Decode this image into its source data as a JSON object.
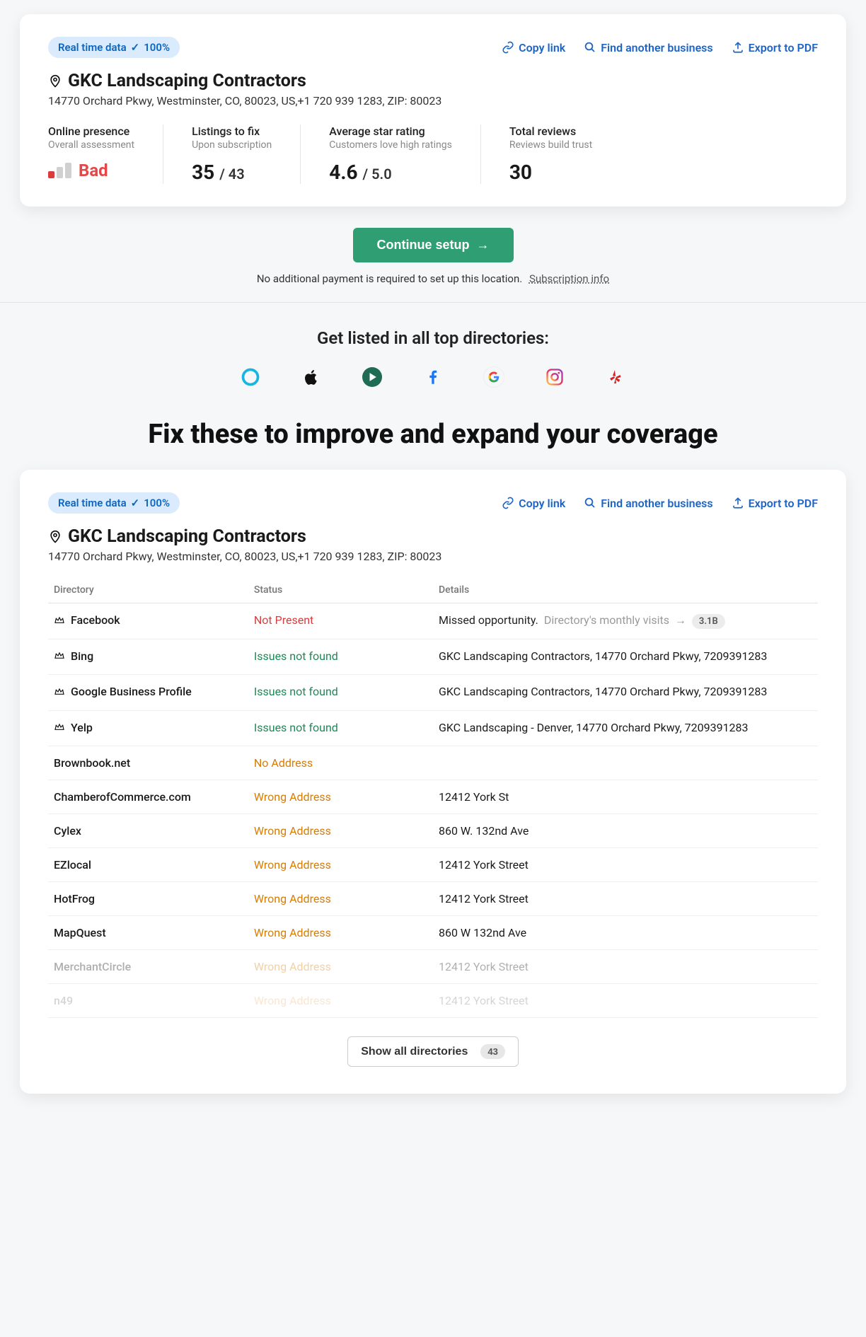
{
  "pill": {
    "label": "Real time data",
    "percent": "100%"
  },
  "actions": {
    "copy": "Copy link",
    "find": "Find another business",
    "export": "Export to PDF"
  },
  "business": {
    "name": "GKC Landscaping Contractors",
    "address": "14770 Orchard Pkwy, Westminster, CO, 80023, US,+1 720 939 1283, ZIP: 80023"
  },
  "stats": {
    "presence": {
      "label": "Online presence",
      "sub": "Overall assessment",
      "value": "Bad"
    },
    "listings": {
      "label": "Listings to fix",
      "sub": "Upon subscription",
      "big": "35",
      "small": "/ 43"
    },
    "rating": {
      "label": "Average star rating",
      "sub": "Customers love high ratings",
      "big": "4.6",
      "small": "/ 5.0"
    },
    "reviews": {
      "label": "Total reviews",
      "sub": "Reviews build trust",
      "big": "30"
    }
  },
  "cta": {
    "button": "Continue setup",
    "note": "No additional payment is required to set up this location.",
    "sub_link": "Subscription info"
  },
  "directories_heading": "Get listed in all top directories:",
  "fix_heading": "Fix these to improve and expand your coverage",
  "table": {
    "headers": {
      "dir": "Directory",
      "status": "Status",
      "details": "Details"
    },
    "missed_text": "Missed opportunity.",
    "missed_sub": "Directory's monthly visits",
    "missed_badge": "3.1B",
    "rows": [
      {
        "name": "Facebook",
        "crown": true,
        "status": "Not Present",
        "status_class": "st-notpresent",
        "details_type": "missed"
      },
      {
        "name": "Bing",
        "crown": true,
        "status": "Issues not found",
        "status_class": "st-good",
        "details": "GKC Landscaping Contractors, 14770 Orchard Pkwy, 7209391283"
      },
      {
        "name": "Google Business Profile",
        "crown": true,
        "status": "Issues not found",
        "status_class": "st-good",
        "details": "GKC Landscaping Contractors, 14770 Orchard Pkwy, 7209391283"
      },
      {
        "name": "Yelp",
        "crown": true,
        "status": "Issues not found",
        "status_class": "st-good",
        "details": "GKC Landscaping - Denver, 14770 Orchard Pkwy, 7209391283"
      },
      {
        "name": "Brownbook.net",
        "crown": false,
        "status": "No Address",
        "status_class": "st-warn",
        "details": ""
      },
      {
        "name": "ChamberofCommerce.com",
        "crown": false,
        "status": "Wrong Address",
        "status_class": "st-warn",
        "details": "12412 York St"
      },
      {
        "name": "Cylex",
        "crown": false,
        "status": "Wrong Address",
        "status_class": "st-warn",
        "details": "860 W. 132nd Ave"
      },
      {
        "name": "EZlocal",
        "crown": false,
        "status": "Wrong Address",
        "status_class": "st-warn",
        "details": "12412 York Street"
      },
      {
        "name": "HotFrog",
        "crown": false,
        "status": "Wrong Address",
        "status_class": "st-warn",
        "details": "12412 York Street"
      },
      {
        "name": "MapQuest",
        "crown": false,
        "status": "Wrong Address",
        "status_class": "st-warn",
        "details": "860 W 132nd Ave"
      },
      {
        "name": "MerchantCircle",
        "crown": false,
        "status": "Wrong Address",
        "status_class": "st-warn",
        "details": "12412 York Street",
        "fade": 1
      },
      {
        "name": "n49",
        "crown": false,
        "status": "Wrong Address",
        "status_class": "st-warn",
        "details": "12412 York Street",
        "fade": 2
      }
    ]
  },
  "show_all": {
    "label": "Show all directories",
    "count": "43"
  }
}
